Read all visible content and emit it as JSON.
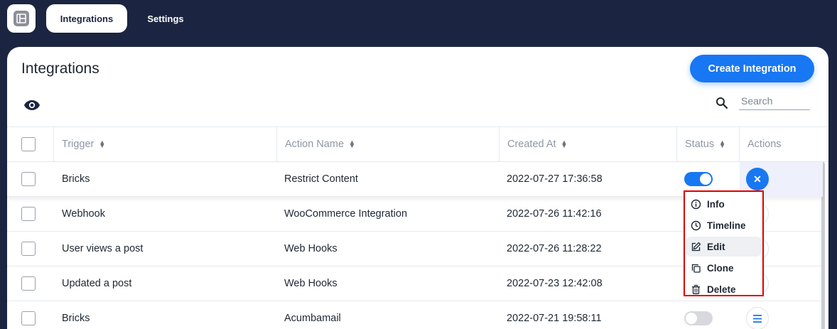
{
  "topnav": {
    "tabs": [
      {
        "label": "Integrations",
        "active": true
      },
      {
        "label": "Settings",
        "active": false
      }
    ]
  },
  "page": {
    "title": "Integrations",
    "create_button": "Create Integration"
  },
  "search": {
    "placeholder": "Search"
  },
  "table": {
    "columns": [
      "Trigger",
      "Action Name",
      "Created At",
      "Status",
      "Actions"
    ],
    "rows": [
      {
        "trigger": "Bricks",
        "action": "Restrict Content",
        "created": "2022-07-27 17:36:58",
        "status": "on"
      },
      {
        "trigger": "Webhook",
        "action": "WooCommerce Integration",
        "created": "2022-07-26 11:42:16",
        "status": "on"
      },
      {
        "trigger": "User views a post",
        "action": "Web Hooks",
        "created": "2022-07-26 11:28:22",
        "status": "on"
      },
      {
        "trigger": "Updated a post",
        "action": "Web Hooks",
        "created": "2022-07-23 12:42:08",
        "status": "on"
      },
      {
        "trigger": "Bricks",
        "action": "Acumbamail",
        "created": "2022-07-21 19:58:11",
        "status": "off"
      }
    ]
  },
  "actions_menu": {
    "items": [
      {
        "label": "Info",
        "icon": "info-icon"
      },
      {
        "label": "Timeline",
        "icon": "clock-icon"
      },
      {
        "label": "Edit",
        "icon": "edit-icon"
      },
      {
        "label": "Clone",
        "icon": "clone-icon"
      },
      {
        "label": "Delete",
        "icon": "trash-icon"
      }
    ]
  },
  "colors": {
    "navbar": "#1b2541",
    "accent": "#1877f2",
    "highlight_border": "#e00000"
  }
}
